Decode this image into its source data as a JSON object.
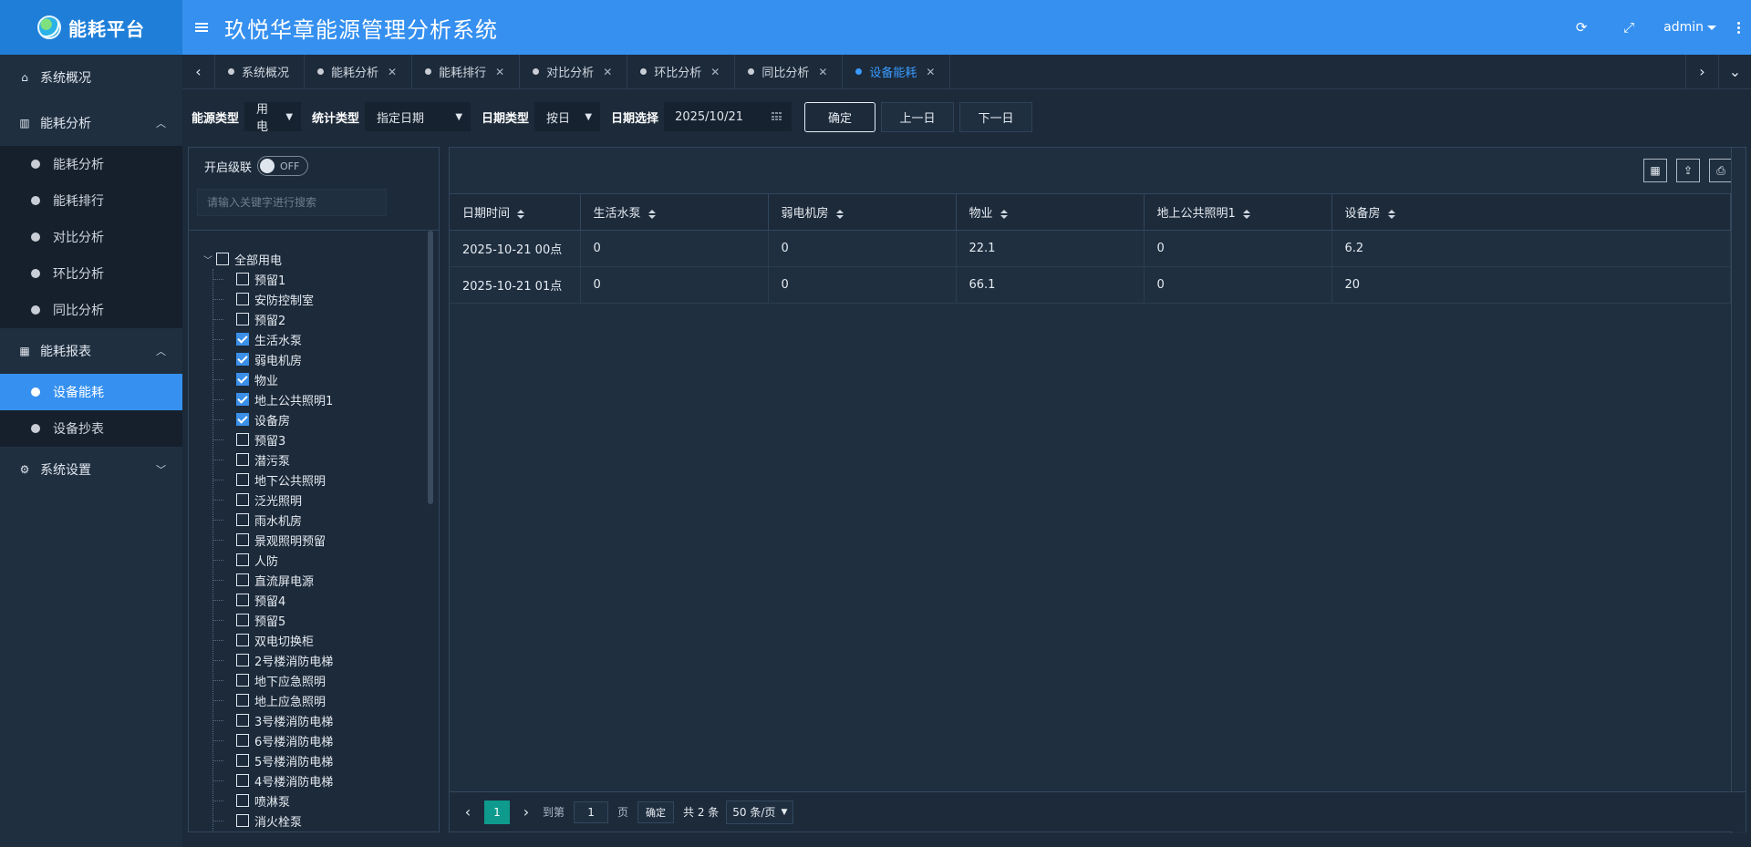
{
  "logo": {
    "text": "能耗平台"
  },
  "header": {
    "title": "玖悦华章能源管理分析系统",
    "user": "admin"
  },
  "sidebar": {
    "groups": [
      {
        "label": "系统概况",
        "icon": "home-icon"
      },
      {
        "label": "能耗分析",
        "icon": "bar-chart-icon",
        "items": [
          "能耗分析",
          "能耗排行",
          "对比分析",
          "环比分析",
          "同比分析"
        ]
      },
      {
        "label": "能耗报表",
        "icon": "table-icon",
        "items": [
          "设备能耗",
          "设备抄表"
        ],
        "active": "设备能耗"
      },
      {
        "label": "系统设置",
        "icon": "gear-icon"
      }
    ]
  },
  "tabs": [
    {
      "label": "系统概况",
      "closable": false
    },
    {
      "label": "能耗分析",
      "closable": true
    },
    {
      "label": "能耗排行",
      "closable": true
    },
    {
      "label": "对比分析",
      "closable": true
    },
    {
      "label": "环比分析",
      "closable": true
    },
    {
      "label": "同比分析",
      "closable": true
    },
    {
      "label": "设备能耗",
      "closable": true,
      "active": true
    }
  ],
  "filter": {
    "energy_type_label": "能源类型",
    "energy_type_value": "用电",
    "stat_type_label": "统计类型",
    "stat_type_value": "指定日期",
    "date_type_label": "日期类型",
    "date_type_value": "按日",
    "date_select_label": "日期选择",
    "date_value": "2025/10/21",
    "confirm": "确定",
    "prev_day": "上一日",
    "next_day": "下一日"
  },
  "tree": {
    "cascade_label": "开启级联",
    "toggle_state": "OFF",
    "search_placeholder": "请输入关键字进行搜索",
    "root_label": "全部用电",
    "nodes": [
      {
        "label": "预留1",
        "checked": false
      },
      {
        "label": "安防控制室",
        "checked": false
      },
      {
        "label": "预留2",
        "checked": false
      },
      {
        "label": "生活水泵",
        "checked": true
      },
      {
        "label": "弱电机房",
        "checked": true
      },
      {
        "label": "物业",
        "checked": true
      },
      {
        "label": "地上公共照明1",
        "checked": true
      },
      {
        "label": "设备房",
        "checked": true
      },
      {
        "label": "预留3",
        "checked": false
      },
      {
        "label": "潜污泵",
        "checked": false
      },
      {
        "label": "地下公共照明",
        "checked": false
      },
      {
        "label": "泛光照明",
        "checked": false
      },
      {
        "label": "雨水机房",
        "checked": false
      },
      {
        "label": "景观照明预留",
        "checked": false
      },
      {
        "label": "人防",
        "checked": false
      },
      {
        "label": "直流屏电源",
        "checked": false
      },
      {
        "label": "预留4",
        "checked": false
      },
      {
        "label": "预留5",
        "checked": false
      },
      {
        "label": "双电切换柜",
        "checked": false
      },
      {
        "label": "2号楼消防电梯",
        "checked": false
      },
      {
        "label": "地下应急照明",
        "checked": false
      },
      {
        "label": "地上应急照明",
        "checked": false
      },
      {
        "label": "3号楼消防电梯",
        "checked": false
      },
      {
        "label": "6号楼消防电梯",
        "checked": false
      },
      {
        "label": "5号楼消防电梯",
        "checked": false
      },
      {
        "label": "4号楼消防电梯",
        "checked": false
      },
      {
        "label": "喷淋泵",
        "checked": false
      },
      {
        "label": "消火栓泵",
        "checked": false
      }
    ]
  },
  "table": {
    "columns": [
      "日期时间",
      "生活水泵",
      "弱电机房",
      "物业",
      "地上公共照明1",
      "设备房"
    ],
    "rows": [
      [
        "2025-10-21 00点",
        "0",
        "0",
        "22.1",
        "0",
        "6.2"
      ],
      [
        "2025-10-21 01点",
        "0",
        "0",
        "66.1",
        "0",
        "20"
      ]
    ]
  },
  "pager": {
    "current": "1",
    "goto_label": "到第",
    "goto_value": "1",
    "page_unit": "页",
    "confirm": "确定",
    "total": "共 2 条",
    "page_size": "50 条/页"
  }
}
